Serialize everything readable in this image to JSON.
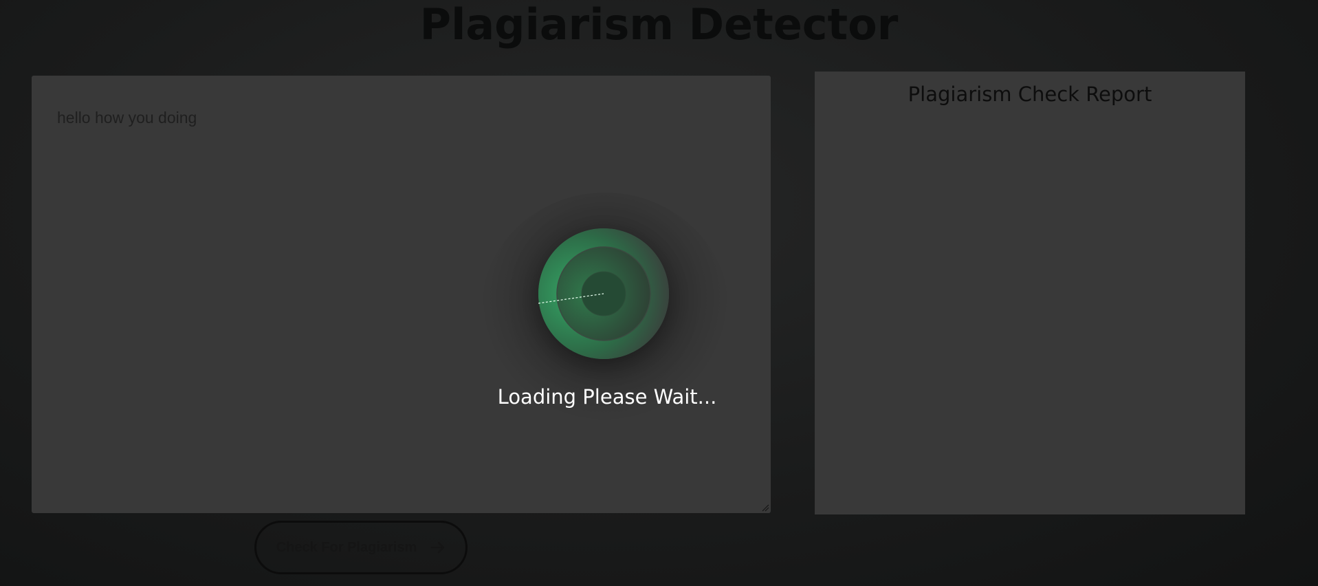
{
  "header": {
    "title": "Plagiarism Detector"
  },
  "editor": {
    "text": "hello how you doing"
  },
  "report": {
    "title": "Plagiarism Check Report"
  },
  "actions": {
    "check_label": "Check For Plagiarism",
    "check_icon": "arrow-right-icon"
  },
  "loader": {
    "text": "Loading Please Wait...",
    "accent": "#34a065"
  },
  "colors": {
    "background": "#1b1c1c",
    "panel": "#393939",
    "title": "#0b0c0c"
  }
}
